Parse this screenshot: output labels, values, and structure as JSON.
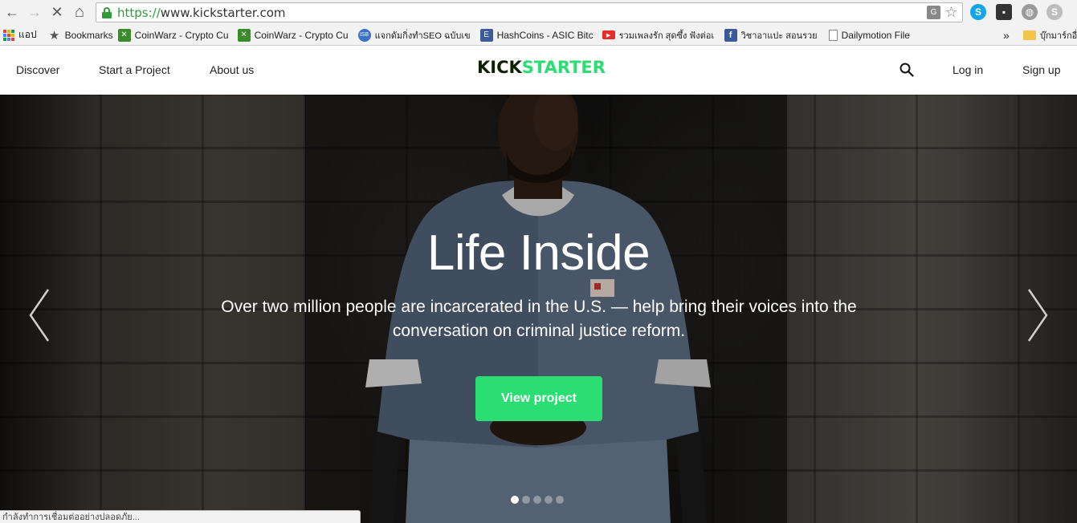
{
  "browser": {
    "url_scheme": "https://",
    "url_host": "www.kickstarter.com",
    "back_glyph": "←",
    "forward_glyph": "→",
    "stop_glyph": "✕",
    "home_glyph": "⌂",
    "star_glyph": "☆",
    "bookmarks": [
      {
        "label": "แอป",
        "icon": "apps-grid-icon"
      },
      {
        "label": "Bookmarks",
        "icon": "star-icon"
      },
      {
        "label": "CoinWarz - Crypto Cu",
        "icon": "coinwarz-icon"
      },
      {
        "label": "CoinWarz - Crypto Cu",
        "icon": "coinwarz-icon"
      },
      {
        "label": "แจกดัมกิ่งทำSEO ฉบับเข",
        "icon": "globe-badge-icon"
      },
      {
        "label": "HashCoins - ASIC Bitc",
        "icon": "hashcoins-icon"
      },
      {
        "label": "รวมเพลงรัก สุดซึ้ง ฟังต่อเ",
        "icon": "youtube-icon"
      },
      {
        "label": "วิชาอาแปะ สอนรวย",
        "icon": "facebook-icon"
      },
      {
        "label": "Dailymotion File",
        "icon": "document-icon"
      }
    ],
    "bookmarks_overflow": "»",
    "other_bookmarks": "บุ๊กมาร์กอื่",
    "status_text": "กำลังทำการเชื่อมต่ออย่างปลอดภัย..."
  },
  "header": {
    "nav_discover": "Discover",
    "nav_start": "Start a Project",
    "nav_about": "About us",
    "logo_kick": "KICK",
    "logo_starter": "STARTER",
    "login": "Log in",
    "signup": "Sign up"
  },
  "hero": {
    "title": "Life Inside",
    "subtitle": "Over two million people are incarcerated in the U.S. — help bring their voices into the conversation on criminal justice reform.",
    "cta": "View project",
    "slide_count": 5,
    "active_slide": 1
  },
  "colors": {
    "brand_green": "#2bde73",
    "brand_dark": "#0f2105"
  }
}
